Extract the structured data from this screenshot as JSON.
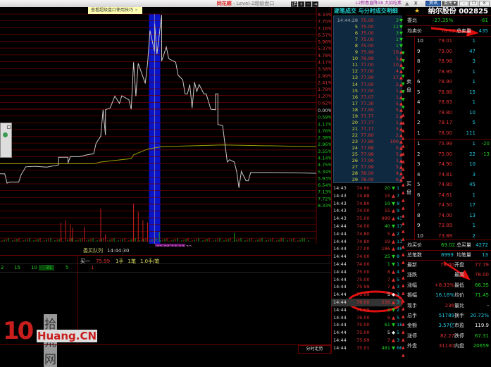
{
  "window": {
    "brand": "同花顺",
    "title": " - Level-2超级盘口",
    "promo1": "L2新春直降18",
    "promo2": "大招吃素",
    "btn_news": "资讯",
    "btn_order": "委托 ▾",
    "min": "–",
    "max": "❐",
    "close": "✕"
  },
  "chart": {
    "tip": "查看超级盘口使用技巧",
    "tip_close": "×",
    "controls": [
      "详",
      "+",
      "−",
      "⇥"
    ],
    "pct_labels_up": [
      "8.33%",
      "7.75%",
      "7.16%",
      "6.57%",
      "5.96%",
      "5.37%",
      "4.78%",
      "4.17%",
      "3.58%",
      "2.99%",
      "2.41%",
      "1.79%",
      "1.20%",
      "0.62%"
    ],
    "zero_label": "0.00%",
    "pct_labels_down": [
      "0.59%",
      "1.17%",
      "1.76%",
      "2.38%",
      "2.96%",
      "3.55%",
      "4.14%",
      "4.75%",
      "5.34%",
      "5.93%",
      "6.54%",
      "7.13%",
      "7.72%",
      "8.33%"
    ],
    "cursor_label": "02-06 14:44:30",
    "prev_close": 72.0,
    "colors": {
      "price": "#c8c8c8",
      "avg": "#a0a000",
      "grid": "#6a0000",
      "highlight": "#0a14c8",
      "up": "#c81e1e",
      "down": "#1ea01e"
    },
    "price_series": [
      [
        0,
        67.97
      ],
      [
        2,
        67.97
      ],
      [
        3,
        67.38
      ],
      [
        4,
        67.45
      ],
      [
        8,
        67.45
      ],
      [
        9,
        67.9
      ],
      [
        11,
        68.41
      ],
      [
        15,
        68.44
      ],
      [
        20,
        68.39
      ],
      [
        25,
        68.53
      ],
      [
        25,
        69.01
      ],
      [
        29,
        69.01
      ],
      [
        29,
        68.64
      ],
      [
        30,
        69.05
      ],
      [
        34,
        69.05
      ],
      [
        37,
        69.16
      ],
      [
        40,
        69.23
      ],
      [
        41,
        69.9
      ],
      [
        43,
        70.34
      ],
      [
        44,
        72.01
      ],
      [
        45,
        70.41
      ],
      [
        45,
        72.01
      ],
      [
        47,
        72.12
      ],
      [
        49,
        72.86
      ],
      [
        51,
        72.41
      ],
      [
        52,
        72.89
      ],
      [
        55,
        72.64
      ],
      [
        56,
        72.04
      ],
      [
        57,
        75.01
      ],
      [
        58,
        72.86
      ],
      [
        59,
        74.93
      ],
      [
        62,
        73.67
      ],
      [
        63,
        74.93
      ],
      [
        64,
        77.01
      ],
      [
        66,
        75.67
      ],
      [
        66,
        77.45
      ],
      [
        67,
        75.52
      ],
      [
        69,
        78.0
      ],
      [
        69,
        75.08
      ],
      [
        71,
        75.97
      ],
      [
        72,
        75.23
      ],
      [
        75,
        75.01
      ],
      [
        76,
        74.19
      ],
      [
        78,
        73.9
      ],
      [
        79,
        73.01
      ],
      [
        80,
        73.01
      ],
      [
        81,
        73.6
      ],
      [
        82,
        72.12
      ],
      [
        83,
        73.75
      ],
      [
        84,
        73.16
      ],
      [
        85,
        73.6
      ],
      [
        87,
        73.01
      ],
      [
        88,
        73.01
      ],
      [
        90,
        72.04
      ],
      [
        92,
        72.01
      ],
      [
        92,
        73.01
      ],
      [
        93,
        73.01
      ],
      [
        93,
        71.08
      ],
      [
        95,
        71.01
      ],
      [
        97,
        68.71
      ],
      [
        98,
        68.86
      ],
      [
        100,
        68.71
      ],
      [
        101,
        68.12
      ],
      [
        102,
        67.08
      ],
      [
        103,
        68.12
      ],
      [
        105,
        67.53
      ],
      [
        106,
        67.53
      ],
      [
        107,
        68.05
      ],
      [
        115,
        68.05
      ],
      [
        125,
        68.03
      ],
      [
        135,
        68.0
      ]
    ],
    "avg_series": [
      [
        0,
        68.6
      ],
      [
        40,
        68.6
      ],
      [
        43,
        68.71
      ],
      [
        56,
        68.93
      ],
      [
        57,
        69.16
      ],
      [
        63,
        69.53
      ],
      [
        69,
        69.68
      ],
      [
        95,
        69.79
      ],
      [
        135,
        69.68
      ]
    ],
    "cursor_seq": 66,
    "volume_bars": [
      [
        26,
        80,
        "up"
      ],
      [
        28,
        90,
        "up"
      ],
      [
        30,
        72,
        "up"
      ],
      [
        31,
        58,
        "up"
      ],
      [
        36,
        62,
        "up"
      ],
      [
        43,
        138,
        "up"
      ],
      [
        45,
        30,
        "up"
      ],
      [
        57,
        158,
        "up"
      ],
      [
        59,
        125,
        "up"
      ],
      [
        61,
        90,
        "up"
      ],
      [
        63,
        80,
        "up"
      ],
      [
        68,
        40,
        "down"
      ],
      [
        100,
        35,
        "down"
      ],
      [
        120,
        15,
        "up"
      ],
      [
        129,
        14,
        "down"
      ]
    ]
  },
  "queue": {
    "title": "委买队列",
    "time": "14:44:30",
    "buy1_label": "买一",
    "buy1_price": "75.99",
    "hands": "1手",
    "orders": "1笔",
    "avg": "1.0手/笔",
    "left_nums": [
      "2",
      "15",
      "10",
      "31",
      "5"
    ],
    "right_first": "1"
  },
  "bottom": {
    "tab": "分时走势"
  },
  "logo": {
    "num": "10",
    "cn": "拾荒网",
    "en": "Huang.CN"
  },
  "ticks": {
    "header": "逐笔成交 与分时成交明细",
    "top": [
      [
        "14:44:28",
        "75.00",
        "3",
        "down"
      ],
      [
        "5",
        "75.00",
        "11",
        "down"
      ],
      [
        "6",
        "75.00",
        "3",
        "down"
      ],
      [
        "7",
        "75.00",
        "1",
        "down"
      ],
      [
        "8",
        "75.00",
        "1",
        "down"
      ],
      [
        "9",
        "75.99",
        "18",
        "up"
      ],
      [
        "10",
        "76.99",
        "1",
        "up"
      ],
      [
        "11",
        "77.00",
        "10",
        "up"
      ],
      [
        "12",
        "77.00",
        "4",
        "up"
      ],
      [
        "13",
        "77.00",
        "17",
        "up"
      ],
      [
        "14",
        "77.00",
        "2",
        "up"
      ],
      [
        "15",
        "77.00",
        "1",
        "up"
      ],
      [
        "16",
        "77.07",
        "1",
        "up"
      ],
      [
        "17",
        "77.30",
        "5",
        "up"
      ],
      [
        "18",
        "77.50",
        "5",
        "up"
      ],
      [
        "19",
        "77.77",
        "2",
        "up"
      ],
      [
        "20",
        "77.77",
        "1",
        "up"
      ],
      [
        "21",
        "77.77",
        "5",
        "up"
      ],
      [
        "22",
        "77.80",
        "2",
        "up"
      ],
      [
        "23",
        "77.80",
        "100",
        "up"
      ],
      [
        "24",
        "77.88",
        "5",
        "up"
      ],
      [
        "25",
        "77.98",
        "5",
        "up"
      ],
      [
        "26",
        "77.99",
        "1",
        "up"
      ],
      [
        "27",
        "77.99",
        "5",
        "up"
      ],
      [
        "28",
        "78.00",
        "4",
        "up"
      ],
      [
        "29",
        "78.00",
        "6",
        "up"
      ]
    ],
    "minute": [
      [
        "14:43",
        "74.80",
        "20",
        "down",
        "1"
      ],
      [
        "14:43",
        "74.88",
        "15",
        "up",
        "7"
      ],
      [
        "14:43",
        "74.80",
        "19",
        "down",
        "8"
      ],
      [
        "14:43",
        "74.00",
        "15",
        "up",
        "9"
      ],
      [
        "14:43",
        "75.00",
        "999",
        "up",
        "43"
      ],
      [
        "14:44",
        "74.00",
        "40",
        "down",
        "17"
      ],
      [
        "14:44",
        "74.80",
        "5",
        "up",
        "2"
      ],
      [
        "14:44",
        "74.80",
        "19",
        "up",
        "11"
      ],
      [
        "14:44",
        "77.00",
        "186",
        "up",
        "48"
      ],
      [
        "14:44",
        "74.00",
        "25",
        "down",
        "8"
      ],
      [
        "14:44",
        "74.00",
        "1",
        "down",
        "1"
      ],
      [
        "14:44",
        "75.00",
        "8",
        "up",
        "4"
      ],
      [
        "14:44",
        "75.00",
        "7",
        "up",
        "5"
      ],
      [
        "14:44",
        "75.99",
        "7",
        "up",
        "3"
      ],
      [
        "14:44",
        "75.99",
        "5",
        "flat",
        "3"
      ],
      [
        "14:44",
        "78.00",
        "236",
        "up",
        "3"
      ],
      [
        "14:44",
        "75.99",
        "2",
        "down",
        "2"
      ],
      [
        "14:44",
        "76.00",
        "9",
        "up",
        "5"
      ],
      [
        "14:44",
        "75.00",
        "61",
        "down",
        "18"
      ],
      [
        "14:44",
        "75.00",
        "5",
        "flat",
        "5"
      ],
      [
        "14:44",
        "75.99",
        "7",
        "up",
        "3"
      ],
      [
        "14:44",
        "75.01",
        "481",
        "down",
        "66"
      ]
    ]
  },
  "quote": {
    "name": "纳尔股份 002825",
    "wb_label": "委比",
    "wb_pct": "-27.35%",
    "wb_diff": "-61",
    "avg_sell_label": "均卖价",
    "avg_sell": "78.83",
    "total_sell_label": "总卖量",
    "total_sell": "435",
    "side_sell": "卖盘",
    "side_buy": "买盘",
    "sells": [
      [
        "10",
        "79.01",
        "1"
      ],
      [
        "9",
        "79.00",
        "47"
      ],
      [
        "8",
        "78.98",
        "3"
      ],
      [
        "7",
        "78.95",
        "1"
      ],
      [
        "6",
        "78.90",
        "1"
      ],
      [
        "5",
        "78.88",
        "15"
      ],
      [
        "4",
        "78.83",
        "1"
      ],
      [
        "3",
        "78.80",
        "10"
      ],
      [
        "2",
        "78.17",
        "5"
      ],
      [
        "1",
        "78.00",
        "111"
      ]
    ],
    "buys": [
      [
        "1",
        "75.99",
        "1",
        "-20"
      ],
      [
        "2",
        "75.00",
        "22",
        "-13"
      ],
      [
        "3",
        "74.90",
        "10",
        ""
      ],
      [
        "4",
        "74.81",
        "3",
        ""
      ],
      [
        "5",
        "74.80",
        "45",
        ""
      ],
      [
        "6",
        "74.61",
        "1",
        ""
      ],
      [
        "7",
        "74.50",
        "17",
        ""
      ],
      [
        "8",
        "74.00",
        "13",
        ""
      ],
      [
        "9",
        "73.89",
        "1",
        ""
      ],
      [
        "10",
        "73.88",
        "2",
        ""
      ]
    ],
    "avg_buy_label": "均买价",
    "avg_buy": "69.02",
    "total_buy_label": "总买量",
    "total_buy": "4272",
    "total_trades_label": "总笔数",
    "total_trades": "8999",
    "avg_trade_label": "均笔量",
    "avg_trade": "13",
    "stats": [
      [
        "最新",
        "78.00",
        "red",
        "开盘",
        "77.79",
        "red"
      ],
      [
        "涨跌",
        "",
        "red",
        "最高",
        "78.00",
        "red"
      ],
      [
        "涨幅",
        "+8.33%",
        "red",
        "最低",
        "66.35",
        "grn"
      ],
      [
        "振幅",
        "16.18%",
        "cyn",
        "均价",
        "71.45",
        "grn"
      ],
      [
        "现手",
        "236",
        "red",
        "量比",
        "-",
        "wht"
      ],
      [
        "总手",
        "51789",
        "cyn",
        "换手",
        "20.72%",
        "cyn"
      ],
      [
        "金额",
        "3.57亿",
        "cyn",
        "市盈",
        "119.9",
        "wht"
      ],
      [
        "涨停",
        "82.27",
        "red",
        "跌停",
        "67.31",
        "grn"
      ],
      [
        "外盘",
        "31130",
        "red",
        "内盘",
        "20659",
        "grn"
      ]
    ],
    "change_value": "−"
  }
}
